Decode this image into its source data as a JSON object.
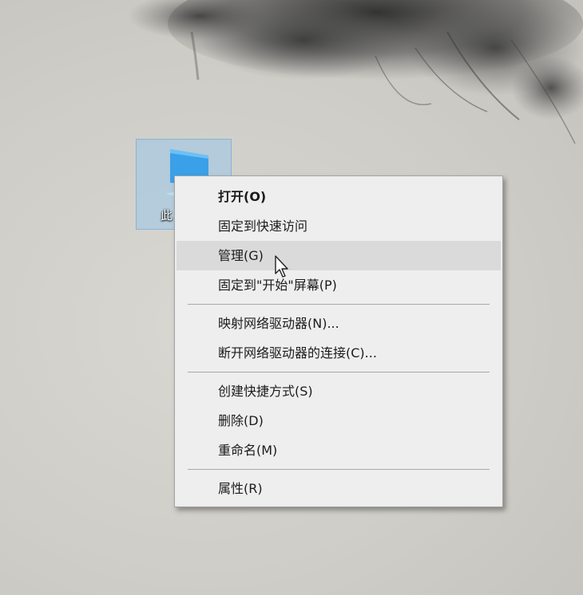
{
  "desktop": {
    "icon": {
      "name": "this-pc",
      "label_visible": "此"
    }
  },
  "context_menu": {
    "items": [
      {
        "label": "打开(O)",
        "bold": true
      },
      {
        "label": "固定到快速访问"
      },
      {
        "label": "管理(G)",
        "hovered": true
      },
      {
        "label": "固定到\"开始\"屏幕(P)"
      },
      {
        "separator": true
      },
      {
        "label": "映射网络驱动器(N)..."
      },
      {
        "label": "断开网络驱动器的连接(C)..."
      },
      {
        "separator": true
      },
      {
        "label": "创建快捷方式(S)"
      },
      {
        "label": "删除(D)"
      },
      {
        "label": "重命名(M)"
      },
      {
        "separator": true
      },
      {
        "label": "属性(R)"
      }
    ]
  },
  "colors": {
    "menu_bg": "#eeeeee",
    "hover_bg": "#dadada",
    "icon_blue": "#3aa0e8"
  },
  "cursor": {
    "type": "arrow-pointer"
  }
}
